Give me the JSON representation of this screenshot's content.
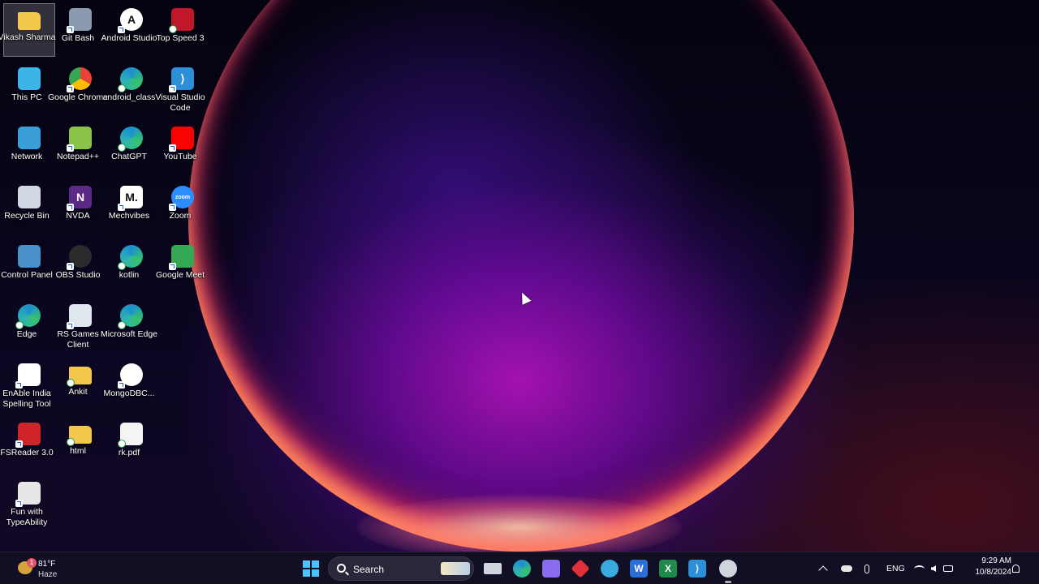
{
  "desktop": {
    "icons": [
      {
        "label": "Vikash Sharma",
        "icon": "folder-icon",
        "color": "#f2c94c"
      },
      {
        "label": "This PC",
        "icon": "computer-icon",
        "color": "#3cb4e6"
      },
      {
        "label": "Network",
        "icon": "network-icon",
        "color": "#3a9fd9"
      },
      {
        "label": "Recycle Bin",
        "icon": "recycle-bin-icon",
        "color": "#cfd8e3"
      },
      {
        "label": "Control Panel",
        "icon": "control-panel-icon",
        "color": "#4a90c9"
      },
      {
        "label": "Edge",
        "icon": "edge-icon",
        "color": "#2fb3b0"
      },
      {
        "label": "EnAble India Spelling Tool",
        "icon": "document-icon",
        "color": "#ffffff"
      },
      {
        "label": "FSReader 3.0",
        "icon": "fsreader-icon",
        "color": "#d0242b"
      },
      {
        "label": "Fun with TypeAbility",
        "icon": "typeability-icon",
        "color": "#e6e6e6"
      },
      {
        "label": "Git Bash",
        "icon": "git-bash-icon",
        "color": "#8a9bb0"
      },
      {
        "label": "Google Chrome",
        "icon": "chrome-icon",
        "color": "#ea4335"
      },
      {
        "label": "Notepad++",
        "icon": "notepad-plus-plus-icon",
        "color": "#8bc34a"
      },
      {
        "label": "NVDA",
        "icon": "nvda-icon",
        "color": "#5b2a86"
      },
      {
        "label": "OBS Studio",
        "icon": "obs-studio-icon",
        "color": "#2b2b2b"
      },
      {
        "label": "RS Games Client",
        "icon": "rs-games-icon",
        "color": "#dfe7ee"
      },
      {
        "label": "Ankit",
        "icon": "folder-icon",
        "color": "#f2c94c"
      },
      {
        "label": "html",
        "icon": "folder-icon",
        "color": "#f2c94c"
      },
      {
        "label": "Android Studio",
        "icon": "android-studio-icon",
        "color": "#ffffff"
      },
      {
        "label": "android_class",
        "icon": "edge-icon",
        "color": "#2fb3b0"
      },
      {
        "label": "ChatGPT",
        "icon": "edge-icon",
        "color": "#2fb3b0"
      },
      {
        "label": "Mechvibes",
        "icon": "mechvibes-icon",
        "color": "#ffffff"
      },
      {
        "label": "kotlin",
        "icon": "edge-icon",
        "color": "#2fb3b0"
      },
      {
        "label": "Microsoft Edge",
        "icon": "edge-icon",
        "color": "#2fb3b0"
      },
      {
        "label": "MongoDBC...",
        "icon": "mongodb-compass-icon",
        "color": "#ffffff"
      },
      {
        "label": "rk.pdf",
        "icon": "pdf-file-icon",
        "color": "#f4f4f4"
      },
      {
        "label": "Top Speed 3",
        "icon": "top-speed-icon",
        "color": "#c0182a"
      },
      {
        "label": "Visual Studio Code",
        "icon": "vscode-icon",
        "color": "#2d8fd8"
      },
      {
        "label": "YouTube",
        "icon": "youtube-icon",
        "color": "#ff0000"
      },
      {
        "label": "Zoom",
        "icon": "zoom-icon",
        "color": "#2d8cff"
      },
      {
        "label": "Google Meet",
        "icon": "google-meet-icon",
        "color": "#34a853"
      }
    ],
    "icon_glyphs": {
      "nvda": "N",
      "mechvibes": "M.",
      "zoom": "zoom",
      "android": "A",
      "vscode": "⟩",
      "excel": "X",
      "word": "W"
    }
  },
  "taskbar": {
    "weather": {
      "temp": "81°F",
      "condition": "Haze",
      "badge": "1"
    },
    "search_label": "Search",
    "pinned": [
      {
        "name": "task-view-icon",
        "color": "#cfd6de"
      },
      {
        "name": "edge-icon",
        "color": "#2fb3b0"
      },
      {
        "name": "copilot-icon",
        "color": "#8a6cf0"
      },
      {
        "name": "app-red-diamond-icon",
        "color": "#e0303a"
      },
      {
        "name": "help-icon",
        "color": "#3aa9e0"
      },
      {
        "name": "word-icon",
        "color": "#2b6fd6"
      },
      {
        "name": "excel-icon",
        "color": "#1f8a4c"
      },
      {
        "name": "vscode-icon",
        "color": "#2d8fd8"
      },
      {
        "name": "app-running-icon",
        "color": "#cfd6de"
      }
    ],
    "tray": {
      "language": "ENG",
      "time": "9:29 AM",
      "date": "10/8/2024"
    }
  },
  "colors": {
    "accent": "#4cc2ff",
    "taskbar_bg": "#121024"
  }
}
